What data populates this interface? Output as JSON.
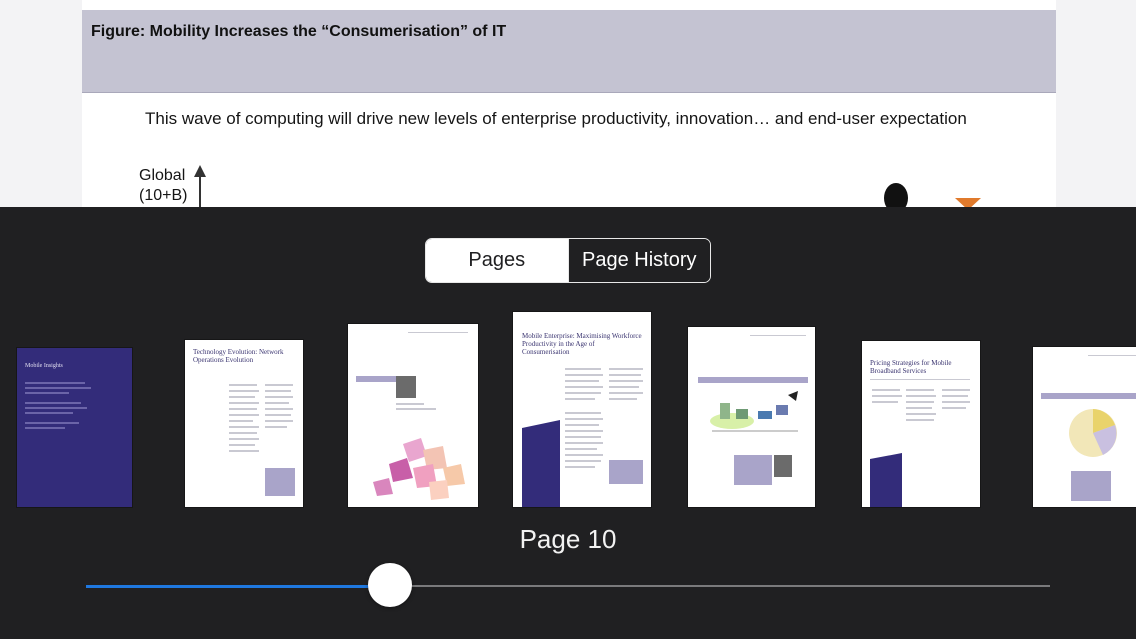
{
  "document": {
    "figure_title": "Figure: Mobility Increases the “Consumerisation” of IT",
    "subtitle": "This wave of computing will drive new levels of enterprise productivity, innovation… and end-user expectation",
    "axis_label": "Global (10+B)"
  },
  "overlay": {
    "tabs": [
      {
        "label": "Pages",
        "selected": false
      },
      {
        "label": "Page History",
        "selected": true
      }
    ],
    "current_page_label": "Page 10",
    "slider_position": 0.315
  },
  "thumbnails": [
    {
      "title": "Mobile Insights"
    },
    {
      "title": "Technology Evolution: Network Operations Evolution"
    },
    {
      "title": ""
    },
    {
      "title": "Mobile Enterprise: Maximising Workforce Productivity in the Age of Consumerisation"
    },
    {
      "title": ""
    },
    {
      "title": "Pricing Strategies for Mobile Broadband Services"
    },
    {
      "title": ""
    }
  ],
  "colors": {
    "accent": "#1f78e0",
    "purple": "#332c7a",
    "figure_bar": "#c4c3d2"
  }
}
